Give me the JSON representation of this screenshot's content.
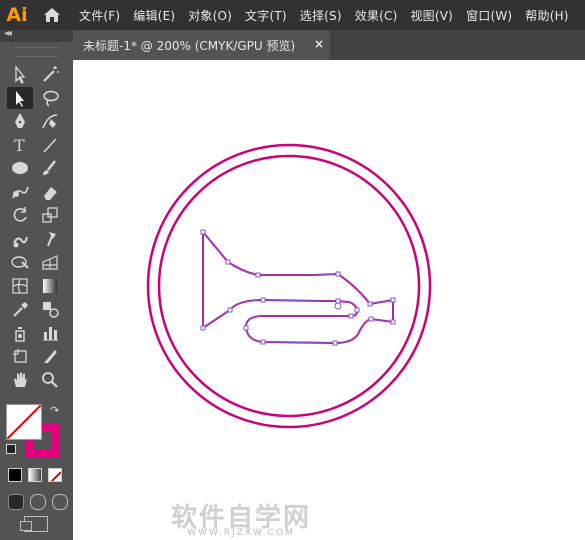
{
  "app": {
    "logo": "Ai",
    "menus": [
      "文件(F)",
      "编辑(E)",
      "对象(O)",
      "文字(T)",
      "选择(S)",
      "效果(C)",
      "视图(V)",
      "窗口(W)",
      "帮助(H)"
    ]
  },
  "document": {
    "tab_title": "未标题-1* @ 200% (CMYK/GPU 预览)",
    "close_glyph": "×"
  },
  "toolbox": {
    "collapse_glyph": "◂◂",
    "tools": [
      "direct-selection-icon",
      "magic-wand-icon",
      "selection-icon",
      "lasso-icon",
      "pen-icon",
      "curvature-icon",
      "type-icon",
      "line-segment-icon",
      "ellipse-icon",
      "paintbrush-icon",
      "shaper-icon",
      "eraser-icon",
      "rotate-icon",
      "scale-icon",
      "warp-icon",
      "puppet-warp-icon",
      "shape-builder-icon",
      "perspective-grid-icon",
      "mesh-icon",
      "gradient-icon",
      "eyedropper-icon",
      "blend-icon",
      "symbol-sprayer-icon",
      "column-graph-icon",
      "artboard-icon",
      "slice-icon",
      "hand-icon",
      "zoom-icon"
    ],
    "fill_color": "#ffffff",
    "stroke_color": "#e4007f"
  },
  "colors": {
    "stroke": "#cc0077",
    "selection": "#7a5cd6"
  },
  "watermark": {
    "text": "软件自学网",
    "sub": "WWW.RJZXW.COM"
  }
}
